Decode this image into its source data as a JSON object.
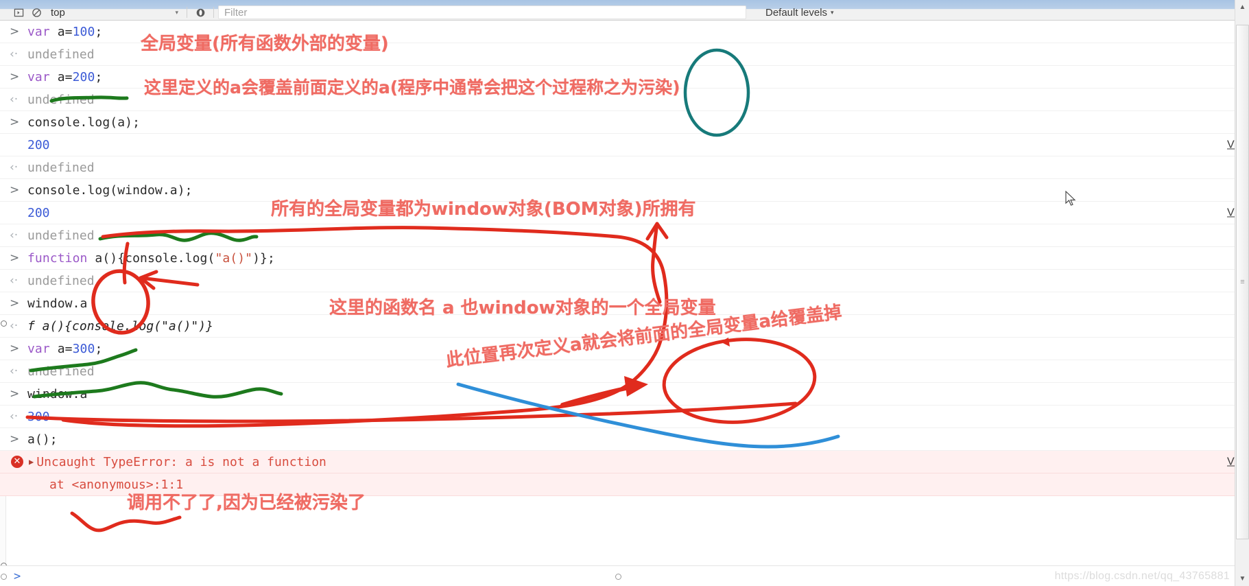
{
  "toolbar": {
    "icons": [
      "inspect-panel-icon",
      "clear-console-icon",
      "eye-icon"
    ],
    "context_value": "top",
    "filter_placeholder": "Filter",
    "levels_label": "Default levels",
    "caret": "▾"
  },
  "console": {
    "rows": [
      {
        "kind": "input",
        "arrow": ">",
        "segments": [
          {
            "t": "var",
            "c": "kw"
          },
          {
            "t": " a=",
            "c": "code"
          },
          {
            "t": "100",
            "c": "num"
          },
          {
            "t": ";",
            "c": "code"
          }
        ],
        "text": "var a=100;",
        "vm": ""
      },
      {
        "kind": "out",
        "arrow": "‹·",
        "text": "undefined",
        "style": "undef",
        "vm": ""
      },
      {
        "kind": "input",
        "arrow": ">",
        "segments": [
          {
            "t": "var",
            "c": "kw"
          },
          {
            "t": " a=",
            "c": "code"
          },
          {
            "t": "200",
            "c": "num"
          },
          {
            "t": ";",
            "c": "code"
          }
        ],
        "text": "var a=200;",
        "vm": ""
      },
      {
        "kind": "out",
        "arrow": "‹·",
        "text": "undefined",
        "style": "undef",
        "vm": ""
      },
      {
        "kind": "input",
        "arrow": ">",
        "segments": [
          {
            "t": "console.log(a);",
            "c": "code"
          }
        ],
        "text": "console.log(a);",
        "vm": ""
      },
      {
        "kind": "log",
        "arrow": "",
        "text": "200",
        "style": "num-out",
        "vm": "VM"
      },
      {
        "kind": "out",
        "arrow": "‹·",
        "text": "undefined",
        "style": "undef",
        "vm": ""
      },
      {
        "kind": "input",
        "arrow": ">",
        "segments": [
          {
            "t": "console.log(window.a);",
            "c": "code"
          }
        ],
        "text": "console.log(window.a);",
        "vm": ""
      },
      {
        "kind": "log",
        "arrow": "",
        "text": "200",
        "style": "num-out",
        "vm": "VM"
      },
      {
        "kind": "out",
        "arrow": "‹·",
        "text": "undefined",
        "style": "undef",
        "vm": ""
      },
      {
        "kind": "input",
        "arrow": ">",
        "segments": [
          {
            "t": "function",
            "c": "kw"
          },
          {
            "t": " a(){console.log(",
            "c": "code"
          },
          {
            "t": "\"a()\"",
            "c": "str"
          },
          {
            "t": ")};",
            "c": "code"
          }
        ],
        "text": "function a(){console.log(\"a()\")};",
        "vm": ""
      },
      {
        "kind": "out",
        "arrow": "‹·",
        "text": "undefined",
        "style": "undef",
        "vm": ""
      },
      {
        "kind": "input",
        "arrow": ">",
        "segments": [
          {
            "t": "window.a",
            "c": "code"
          }
        ],
        "text": "window.a",
        "vm": ""
      },
      {
        "kind": "out",
        "arrow": "‹·",
        "text": "f a(){console.log(\"a()\")}",
        "style": "fnres",
        "vm": ""
      },
      {
        "kind": "input",
        "arrow": ">",
        "segments": [
          {
            "t": "var",
            "c": "kw"
          },
          {
            "t": " a=",
            "c": "code"
          },
          {
            "t": "300",
            "c": "num"
          },
          {
            "t": ";",
            "c": "code"
          }
        ],
        "text": "var a=300;",
        "vm": ""
      },
      {
        "kind": "out",
        "arrow": "‹·",
        "text": "undefined",
        "style": "undef",
        "vm": ""
      },
      {
        "kind": "input",
        "arrow": ">",
        "segments": [
          {
            "t": "window.a",
            "c": "code"
          }
        ],
        "text": "window.a",
        "vm": ""
      },
      {
        "kind": "out",
        "arrow": "‹·",
        "text": "300",
        "style": "num-out",
        "vm": ""
      },
      {
        "kind": "input",
        "arrow": ">",
        "segments": [
          {
            "t": "a();",
            "c": "code"
          }
        ],
        "text": "a();",
        "vm": ""
      },
      {
        "kind": "error",
        "arrow": "",
        "text": "Uncaught TypeError: a is not a function",
        "vm": "VM"
      },
      {
        "kind": "error2",
        "arrow": "",
        "text": "at <anonymous>:1:1",
        "vm": ""
      }
    ],
    "error_expand_triangle": "▶",
    "error_badge": "✕"
  },
  "prompt": {
    "arrow": ">",
    "watermark": "https://blog.csdn.net/qq_43765881"
  },
  "scrollbar": {
    "up_arrow": "▲",
    "down_arrow": "▼",
    "grip": "≡"
  },
  "annotations": [
    {
      "id": "ann-global-var",
      "text": "全局变量(所有函数外部的变量)"
    },
    {
      "id": "ann-cover",
      "text": "这里定义的a会覆盖前面定义的a(程序中通常会把这个过程称之为污染)"
    },
    {
      "id": "ann-window-owns",
      "text": "所有的全局变量都为window对象(BOM对象)所拥有"
    },
    {
      "id": "ann-fn-name",
      "text": "这里的函数名 a 也window对象的一个全局变量"
    },
    {
      "id": "ann-redefine",
      "text": "此位置再次定义a就会将前面的全局变量a给覆盖掉"
    },
    {
      "id": "ann-cannot-call",
      "text": "调用不了了,因为已经被污染了"
    }
  ],
  "colors": {
    "annotation_red": "#ef6b63",
    "ink_red": "#e02b1d",
    "ink_green": "#1d7a1d",
    "ink_blue": "#2f8fd8",
    "ink_teal": "#177a7a",
    "keyword_purple": "#9b59c8",
    "number_blue": "#3b5ad6",
    "error_red": "#d84c3f"
  }
}
